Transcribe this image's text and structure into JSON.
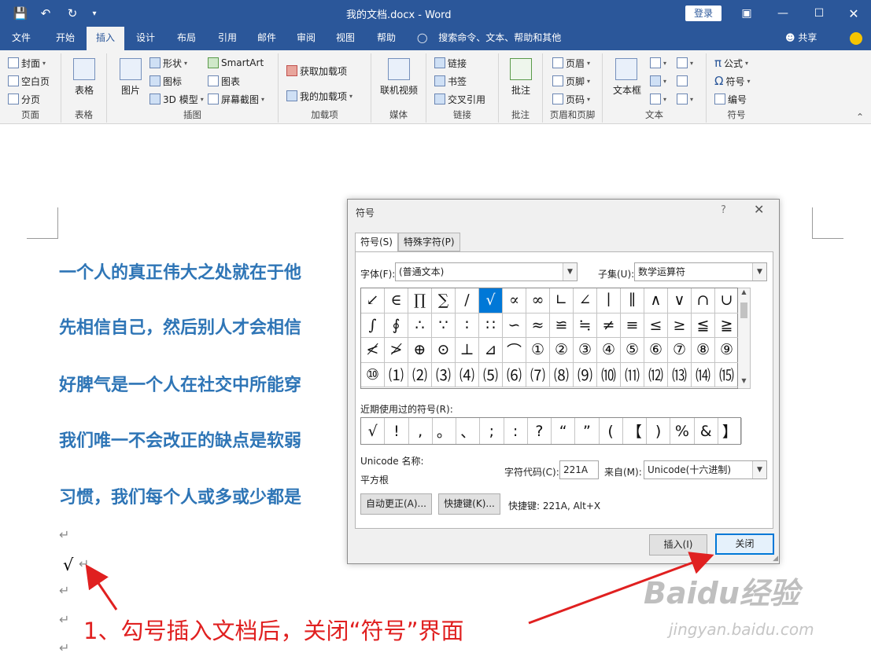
{
  "window": {
    "title": "我的文档.docx - Word",
    "login_label": "登录",
    "controls": [
      "restore-ribbon",
      "minimize",
      "maximize",
      "close"
    ]
  },
  "ribbon": {
    "tabs": [
      {
        "label": "文件",
        "active": false
      },
      {
        "label": "开始",
        "active": false
      },
      {
        "label": "插入",
        "active": true
      },
      {
        "label": "设计",
        "active": false
      },
      {
        "label": "布局",
        "active": false
      },
      {
        "label": "引用",
        "active": false
      },
      {
        "label": "邮件",
        "active": false
      },
      {
        "label": "审阅",
        "active": false
      },
      {
        "label": "视图",
        "active": false
      },
      {
        "label": "帮助",
        "active": false
      }
    ],
    "help_search": "搜索命令、文本、帮助和其他",
    "share_label": "共享",
    "groups": {
      "pages": {
        "label": "页面",
        "items": [
          "封面",
          "空白页",
          "分页"
        ]
      },
      "tables": {
        "label": "表格",
        "items": [
          "表格"
        ]
      },
      "illustrations": {
        "label": "插图",
        "items": [
          "图片",
          "形状",
          "图标",
          "3D 模型",
          "SmartArt",
          "图表",
          "屏幕截图"
        ]
      },
      "addins": {
        "label": "加载项",
        "items": [
          "获取加载项",
          "我的加载项"
        ]
      },
      "media": {
        "label": "媒体",
        "items": [
          "联机视频"
        ]
      },
      "links": {
        "label": "链接",
        "items": [
          "链接",
          "书签",
          "交叉引用"
        ]
      },
      "comments": {
        "label": "批注",
        "items": [
          "批注"
        ]
      },
      "header_footer": {
        "label": "页眉和页脚",
        "items": [
          "页眉",
          "页脚",
          "页码"
        ]
      },
      "text": {
        "label": "文本",
        "items": [
          "文本框"
        ]
      },
      "symbols": {
        "label": "符号",
        "items": [
          "公式",
          "符号",
          "编号"
        ]
      }
    }
  },
  "document": {
    "lines": [
      "一个人的真正伟大之处就在于他",
      "先相信自己，然后别人才会相信",
      "好脾气是一个人在社交中所能穿",
      "我们唯一不会改正的缺点是软弱",
      "习惯，我们每个人或多或少都是"
    ],
    "paragraph_mark": "↵",
    "inserted_symbol": "√",
    "annotation": "1、勾号插入文档后，关闭“符号”界面",
    "watermark": "Baidu经验",
    "watermark_url": "jingyan.baidu.com"
  },
  "dialog": {
    "title": "符号",
    "help": "?",
    "tabs": [
      "符号(S)",
      "特殊字符(P)"
    ],
    "font_label": "字体(F):",
    "font_value": "(普通文本)",
    "subset_label": "子集(U):",
    "subset_value": "数学运算符",
    "symbols": [
      "↙",
      "∈",
      "∏",
      "∑",
      "∕",
      "√",
      "∝",
      "∞",
      "∟",
      "∠",
      "∣",
      "∥",
      "∧",
      "∨",
      "∩",
      "∪",
      "∫",
      "∮",
      "∴",
      "∵",
      "∶",
      "∷",
      "∽",
      "≈",
      "≌",
      "≒",
      "≠",
      "≡",
      "≤",
      "≥",
      "≦",
      "≧",
      "≮",
      "≯",
      "⊕",
      "⊙",
      "⊥",
      "⊿",
      "⌒",
      "①",
      "②",
      "③",
      "④",
      "⑤",
      "⑥",
      "⑦",
      "⑧",
      "⑨",
      "⑩",
      "⑴",
      "⑵",
      "⑶",
      "⑷",
      "⑸",
      "⑹",
      "⑺",
      "⑻",
      "⑼",
      "⑽",
      "⑾",
      "⑿",
      "⒀",
      "⒁",
      "⒂"
    ],
    "selected_index": 5,
    "recent_label": "近期使用过的符号(R):",
    "recent": [
      "√",
      "!",
      ",",
      "。",
      "、",
      ";",
      ":",
      "?",
      "“",
      "”",
      "(",
      "【",
      ")",
      "%",
      "&",
      "】"
    ],
    "unicode_name_label": "Unicode 名称:",
    "unicode_name": "平方根",
    "char_code_label": "字符代码(C):",
    "char_code": "221A",
    "from_label": "来自(M):",
    "from_value": "Unicode(十六进制)",
    "autocorrect_label": "自动更正(A)...",
    "shortcut_key_label": "快捷键(K)...",
    "shortcut_text": "快捷键: 221A, Alt+X",
    "insert_label": "插入(I)",
    "close_label": "关闭"
  },
  "colors": {
    "titlebar": "#2b579a",
    "doc_text": "#2e75b6",
    "annotation": "#e02020",
    "selection": "#0078d7"
  }
}
